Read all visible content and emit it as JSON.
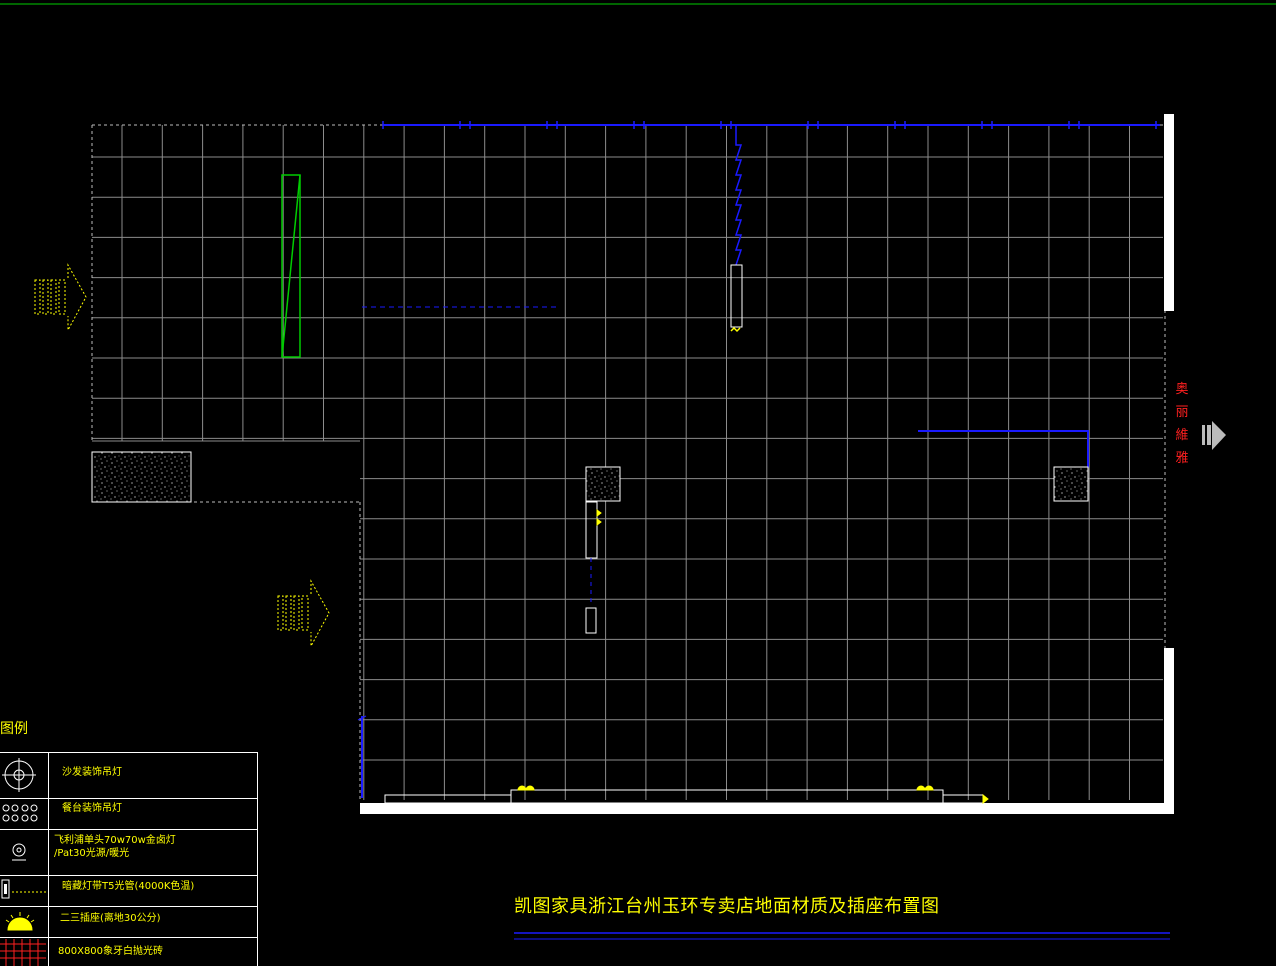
{
  "colors": {
    "background": "#000000",
    "grid": "#8c8c8c",
    "wire": "#1a1aff",
    "wall": "#ffffff",
    "text": "#ffff00",
    "highlight": "#00cc00",
    "side_label": "#ff2020"
  },
  "drawing": {
    "title": "凯图家具浙江台州玉环专卖店地面材质及插座布置图",
    "side_label": "奥丽維雅"
  },
  "legend": {
    "title": "图例",
    "items": [
      {
        "icon": "crosshair-lamp-icon",
        "label": "沙发装饰吊灯"
      },
      {
        "icon": "dotted-lamp-row-icon",
        "label": "餐台装饰吊灯"
      },
      {
        "icon": "spotlight-icon",
        "label": "飞利浦单头70w70w金卤灯\n/Pat30光源/暖光"
      },
      {
        "icon": "t5-light-strip-icon",
        "label": "暗藏灯带T5光管(4000K色温)"
      },
      {
        "icon": "floor-socket-icon",
        "label": "二三插座(离地30公分)"
      },
      {
        "icon": "floor-tile-icon",
        "label": "800X800象牙白抛光砖"
      }
    ]
  }
}
